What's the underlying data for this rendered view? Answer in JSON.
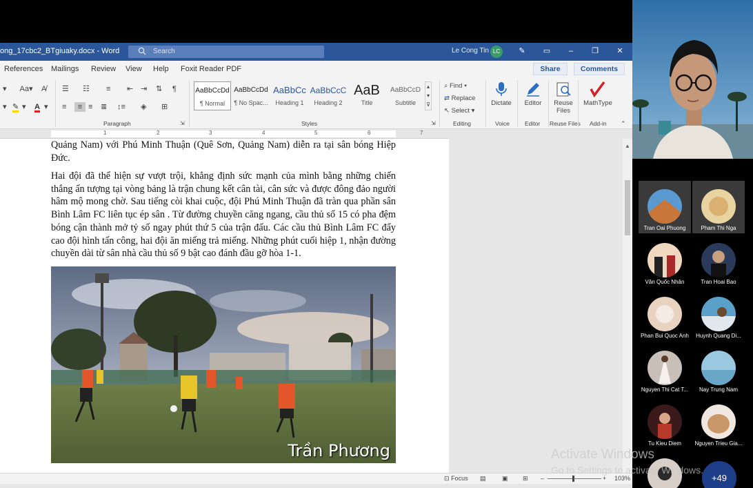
{
  "titlebar": {
    "doc_title": "ong_17cbc2_BTgiuaky.docx  -  Word",
    "search_placeholder": "Search",
    "user_name": "Le Cong Tin",
    "user_initials": "LC"
  },
  "tabs": [
    "References",
    "Mailings",
    "Review",
    "View",
    "Help",
    "Foxit Reader PDF"
  ],
  "share_label": "Share",
  "comments_label": "Comments",
  "ribbon": {
    "font_size_label": "Aa",
    "paragraph_label": "Paragraph",
    "styles_label": "Styles",
    "styles": [
      {
        "sample": "AaBbCcDd",
        "name": "¶ Normal"
      },
      {
        "sample": "AaBbCcDd",
        "name": "¶ No Spac..."
      },
      {
        "sample": "AaBbCc",
        "name": "Heading 1"
      },
      {
        "sample": "AaBbCcC",
        "name": "Heading 2"
      },
      {
        "sample": "AaB",
        "name": "Title"
      },
      {
        "sample": "AaBbCcD",
        "name": "Subtitle"
      }
    ],
    "find_label": "Find",
    "replace_label": "Replace",
    "select_label": "Select",
    "editing_label": "Editing",
    "dictate_label": "Dictate",
    "voice_label": "Voice",
    "editor_label": "Editor",
    "editor_group_label": "Editor",
    "reuse_files_label": "Reuse Files",
    "reuse_files_group_label": "Reuse Files",
    "mathtype_label": "MathType",
    "addin_label": "Add-in"
  },
  "ruler_numbers": [
    "1",
    "1",
    "2",
    "3",
    "4",
    "5",
    "6",
    "7"
  ],
  "document": {
    "para1": "Quảng Nam) với Phú Minh Thuận (Quê Sơn, Quảng Nam) diễn ra tại sân bóng Hiệp Đức.",
    "para2": "Hai đội đã thể hiện sự vượt trội, khẳng định sức mạnh của mình bằng những chiến thắng ấn tượng tại vòng bảng là trận chung kết cân tài, cân sức và được đông đảo người hâm mộ mong chờ. Sau tiếng còi khai cuộc, đội Phú Minh Thuận đã tràn qua phần sân Bình Lâm FC liên tục ép sân . Từ đường chuyền căng ngang, cầu thủ số 15 có pha đệm bóng cận thành mở tỷ số ngay phút thứ 5 của trận đấu. Các cầu thủ Bình Lâm FC đẩy cao đội hình tấn công, hai đội ăn miếng trả miếng. Những phút cuối hiệp 1, nhận đường chuyền dài từ sân nhà cầu thủ số 9 bật cao đánh đầu gỡ hòa 1-1.",
    "photo_caption": "Trần Phương"
  },
  "statusbar": {
    "focus_label": "Focus",
    "zoom": "103%"
  },
  "participants": [
    {
      "name": "Tran Oai Phuong",
      "color": "#c9763a"
    },
    {
      "name": "Pham Thi Nga",
      "color": "#d9b070"
    },
    {
      "name": "Văn Quốc Nhân",
      "color": "#f0d8c0"
    },
    {
      "name": "Tran Hoai Bao",
      "color": "#2a3a5a"
    },
    {
      "name": "Phan Bui Quoc Anh",
      "color": "#e8d2c0"
    },
    {
      "name": "Huynh Quang Di...",
      "color": "#5aa0c8"
    },
    {
      "name": "Nguyen Thi Cat T...",
      "color": "#c8c0b8"
    },
    {
      "name": "Nay Trung Nam",
      "color": "#9ac8e0"
    },
    {
      "name": "Tu Kieu Diem",
      "color": "#b83a2a"
    },
    {
      "name": "Nguyen Trieu Gia...",
      "color": "#c89868"
    }
  ],
  "more_count": "+49",
  "watermark": {
    "line1": "Activate Windows",
    "line2": "Go to Settings to activate Windows."
  }
}
